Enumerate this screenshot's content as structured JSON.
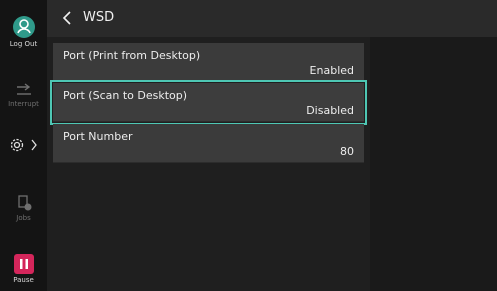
{
  "header": {
    "title": "WSD"
  },
  "rail": {
    "logout_label": "Log Out",
    "interrupt_label": "Interrupt",
    "jobs_label": "Jobs",
    "pause_label": "Pause"
  },
  "settings": [
    {
      "label": "Port (Print from Desktop)",
      "value": "Enabled"
    },
    {
      "label": "Port (Scan to Desktop)",
      "value": "Disabled"
    },
    {
      "label": "Port Number",
      "value": "80"
    }
  ],
  "colors": {
    "accent": "#4ec7b4",
    "logout": "#2f9a8a",
    "pause": "#d4265b"
  }
}
